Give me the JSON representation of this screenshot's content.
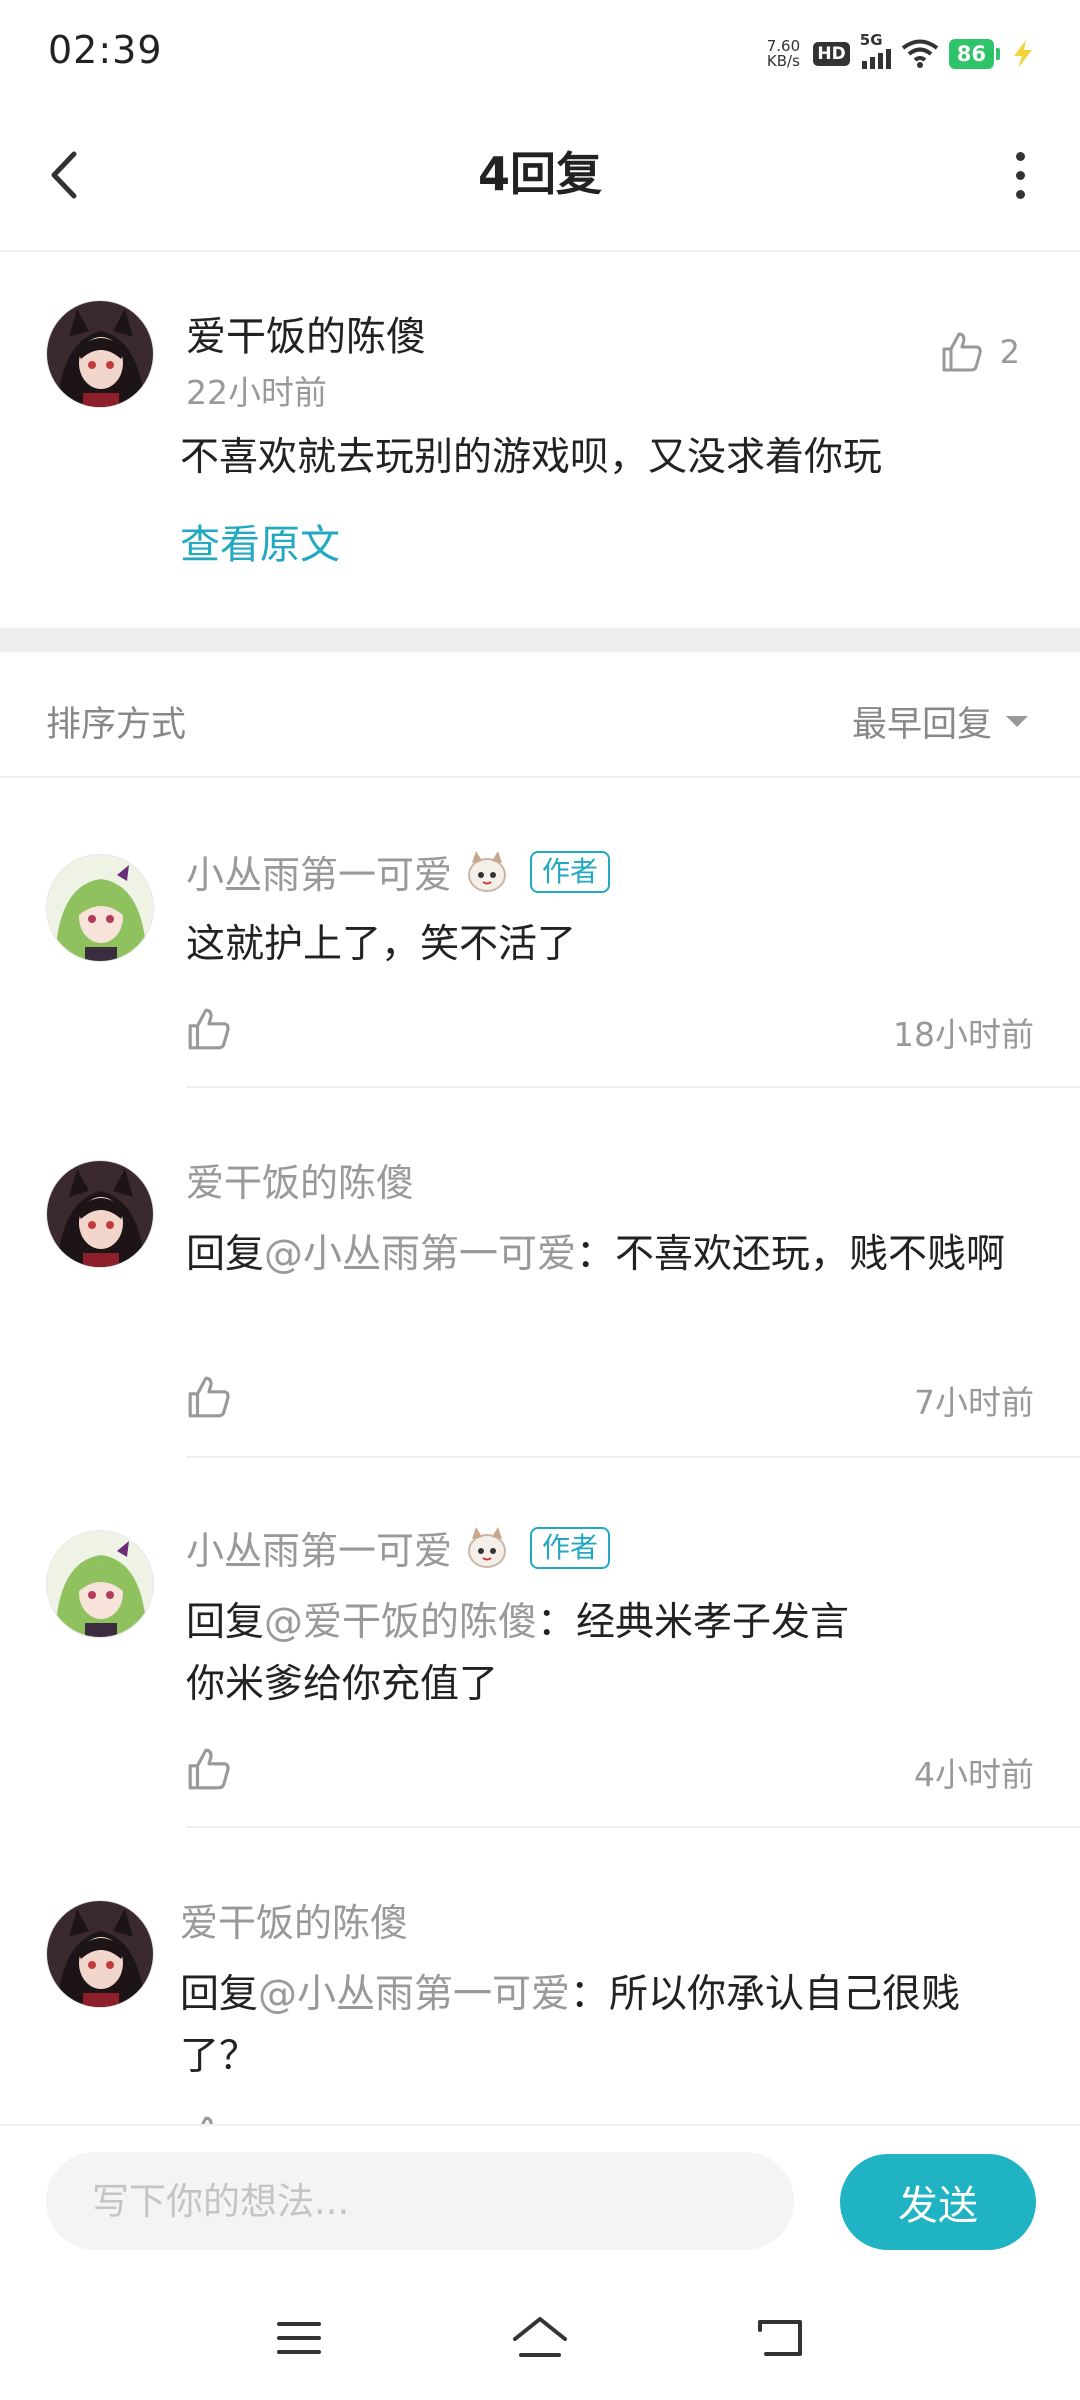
{
  "status_bar": {
    "time": "02:39",
    "net_speed_value": "7.60",
    "net_speed_unit": "KB/s",
    "hd_label": "HD",
    "network_label": "5G",
    "battery": "86"
  },
  "header": {
    "title": "4回复"
  },
  "original_post": {
    "author": "爱干饭的陈傻",
    "time": "22小时前",
    "likes": "2",
    "content": "不喜欢就去玩别的游戏呗，又没求着你玩",
    "view_original_label": "查看原文"
  },
  "sort": {
    "label": "排序方式",
    "selected": "最早回复"
  },
  "replies": [
    {
      "author": "小丛雨第一可爱",
      "is_author": true,
      "author_tag": "作者",
      "prefix": "",
      "mention": "",
      "text": "这就护上了，笑不活了",
      "time": "18小时前"
    },
    {
      "author": "爱干饭的陈傻",
      "is_author": false,
      "author_tag": "",
      "prefix": "回复",
      "mention": "@小丛雨第一可爱",
      "text": "：不喜欢还玩，贱不贱啊",
      "time": "7小时前"
    },
    {
      "author": "小丛雨第一可爱",
      "is_author": true,
      "author_tag": "作者",
      "prefix": "回复",
      "mention": "@爱干饭的陈傻",
      "text": "：经典米孝子发言",
      "text2": "你米爹给你充值了",
      "time": "4小时前"
    },
    {
      "author": "爱干饭的陈傻",
      "is_author": false,
      "author_tag": "",
      "prefix": "回复",
      "mention": "@小丛雨第一可爱",
      "text": "：所以你承认自己很贱了？",
      "time": ""
    }
  ],
  "input": {
    "placeholder": "写下你的想法...",
    "send_label": "发送"
  },
  "colors": {
    "accent": "#23a8c2",
    "send_button": "#1fb3c4",
    "battery": "#2fc36a",
    "muted_text": "#999999"
  }
}
